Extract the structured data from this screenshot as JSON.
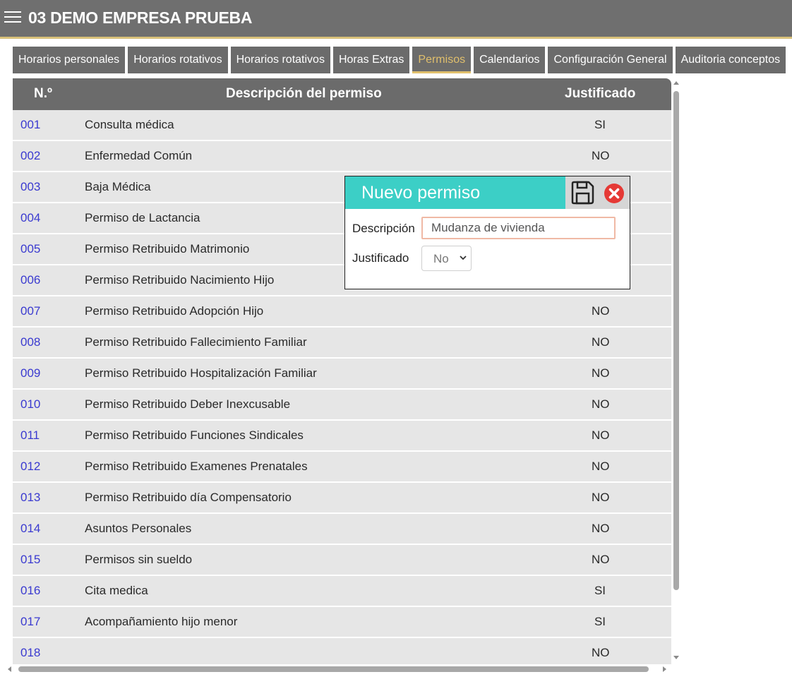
{
  "header": {
    "title": "03 DEMO EMPRESA PRUEBA"
  },
  "tabs": [
    {
      "label": "Horarios personales"
    },
    {
      "label": "Horarios rotativos"
    },
    {
      "label": "Horarios rotativos"
    },
    {
      "label": "Horas Extras"
    },
    {
      "label": "Permisos",
      "active": true
    },
    {
      "label": "Calendarios"
    },
    {
      "label": "Configuración General"
    },
    {
      "label": "Auditoria conceptos"
    }
  ],
  "table": {
    "columns": [
      "N.º",
      "Descripción del permiso",
      "Justificado"
    ],
    "rows": [
      {
        "num": "001",
        "desc": "Consulta médica",
        "just": "SI"
      },
      {
        "num": "002",
        "desc": "Enfermedad Común",
        "just": "NO"
      },
      {
        "num": "003",
        "desc": "Baja Médica",
        "just": ""
      },
      {
        "num": "004",
        "desc": "Permiso de Lactancia",
        "just": ""
      },
      {
        "num": "005",
        "desc": "Permiso Retribuido Matrimonio",
        "just": ""
      },
      {
        "num": "006",
        "desc": "Permiso Retribuido Nacimiento Hijo",
        "just": ""
      },
      {
        "num": "007",
        "desc": "Permiso Retribuido Adopción Hijo",
        "just": "NO"
      },
      {
        "num": "008",
        "desc": "Permiso Retribuido Fallecimiento Familiar",
        "just": "NO"
      },
      {
        "num": "009",
        "desc": "Permiso Retribuido Hospitalización Familiar",
        "just": "NO"
      },
      {
        "num": "010",
        "desc": "Permiso Retribuido Deber Inexcusable",
        "just": "NO"
      },
      {
        "num": "011",
        "desc": "Permiso Retribuido Funciones Sindicales",
        "just": "NO"
      },
      {
        "num": "012",
        "desc": "Permiso Retribuido Examenes Prenatales",
        "just": "NO"
      },
      {
        "num": "013",
        "desc": "Permiso Retribuido día Compensatorio",
        "just": "NO"
      },
      {
        "num": "014",
        "desc": "Asuntos Personales",
        "just": "NO"
      },
      {
        "num": "015",
        "desc": "Permisos sin sueldo",
        "just": "NO"
      },
      {
        "num": "016",
        "desc": "Cita medica",
        "just": "SI"
      },
      {
        "num": "017",
        "desc": "Acompañamiento hijo menor",
        "just": "SI"
      },
      {
        "num": "018",
        "desc": "",
        "just": "NO"
      }
    ]
  },
  "dialog": {
    "title": "Nuevo permiso",
    "description_label": "Descripción",
    "description_value": "Mudanza de vivienda",
    "justified_label": "Justificado",
    "justified_value": "No"
  },
  "colors": {
    "header_bg": "#6f6f6f",
    "accent_gold": "#e0bf6c",
    "dialog_header": "#3ccfc6",
    "link_blue": "#3a3ad0",
    "close_red": "#e53935"
  },
  "icons": [
    "hamburger-menu-icon",
    "save-icon",
    "close-icon",
    "chevron-down-icon"
  ]
}
